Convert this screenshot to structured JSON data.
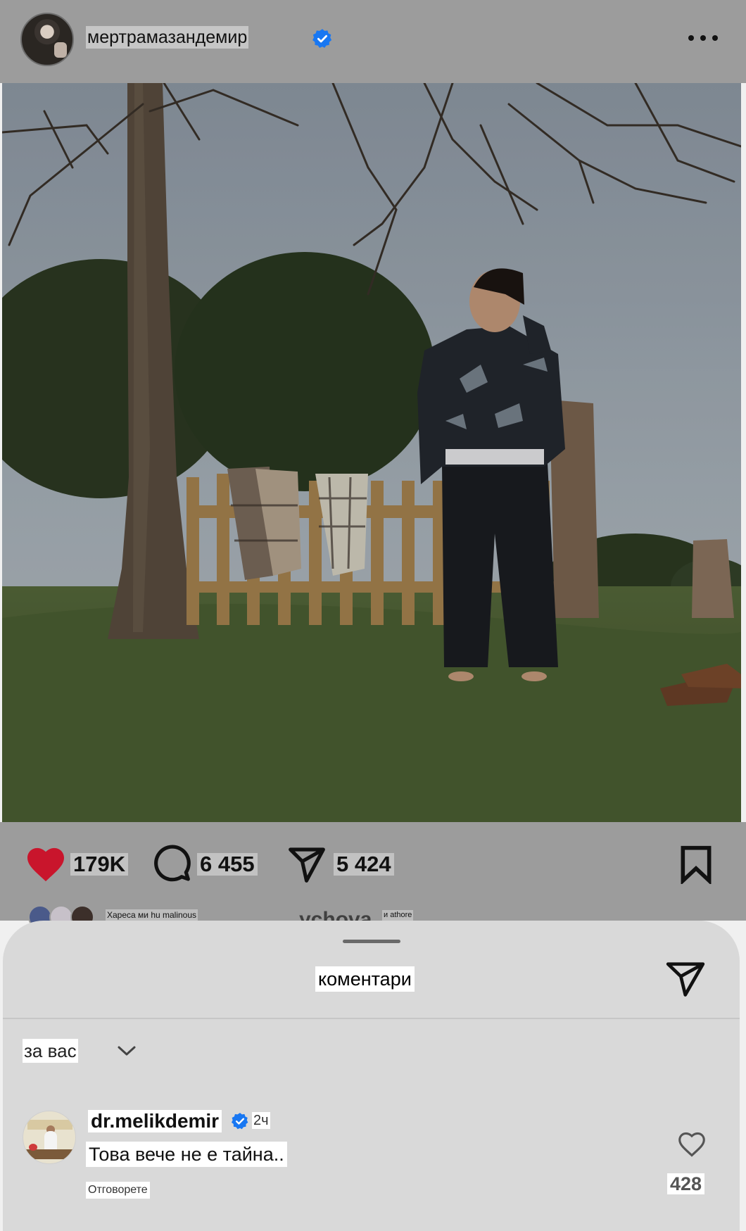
{
  "header": {
    "username": "мертрамазандемир",
    "verified_icon": "verified-badge-icon",
    "more_icon": "more-options-icon"
  },
  "post": {
    "photo_icon": "post-photo"
  },
  "actions": {
    "likes": "179K",
    "comments": "6 455",
    "shares": "5 424",
    "like_color": "#c9152c"
  },
  "likers": {
    "text": "Хареса ми hu malinous",
    "name": "ychova",
    "others": "и athore"
  },
  "comments_sheet": {
    "title": "коментари",
    "sort_label": "за вас",
    "comments": [
      {
        "username": "dr.melikdemir",
        "time": "2ч",
        "text": "Това вече не е тайна..",
        "reply_label": "Отговорете",
        "like_count": "428"
      }
    ]
  },
  "colors": {
    "verified": "#1877f2",
    "sheet_bg": "#d9d9d9",
    "header_bg": "#9c9c9c"
  }
}
